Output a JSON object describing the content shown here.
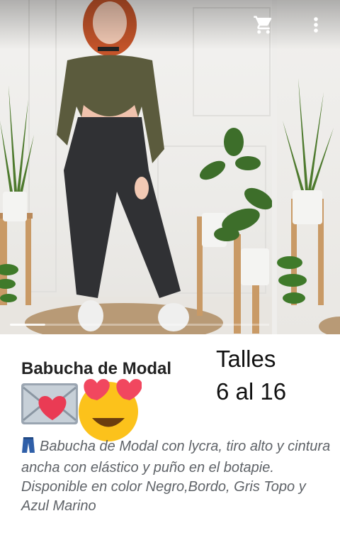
{
  "toolbar": {
    "cart_icon": "cart-icon",
    "more_icon": "more-vert-icon"
  },
  "gallery": {
    "current_index": 1,
    "image_description_colors": {
      "top": "#5a5a3c",
      "pants": "#2f3033",
      "shoes": "#efefef"
    }
  },
  "product": {
    "title": "Babucha de Modal",
    "emoji": "envelope-heart, heart-eyes-face",
    "sizes_line1": "Talles",
    "sizes_line2": "6 al 16",
    "description_icon": "jeans-icon",
    "description": "Babucha de Modal con lycra, tiro alto y cintura ancha con elástico y puño en el botapie. Disponible en color Negro,Bordo, Gris Topo y Azul Marino"
  }
}
